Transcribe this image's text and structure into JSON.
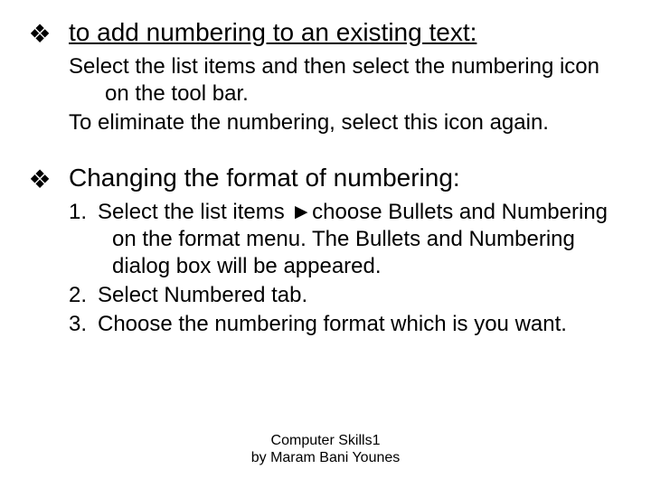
{
  "bullet_symbol": "❖",
  "section1": {
    "heading": "to add numbering to an existing text:",
    "para1": "Select the list items and then select the numbering icon on the tool bar.",
    "para2": "To eliminate the numbering, select this icon again."
  },
  "section2": {
    "heading": "Changing the format of numbering:",
    "items": {
      "n1": "1.",
      "t1": "Select the list items ►choose Bullets and Numbering on the format menu. The Bullets and Numbering dialog box will be appeared.",
      "n2": "2.",
      "t2": "Select Numbered tab.",
      "n3": "3.",
      "t3": "Choose the numbering format which is you want."
    }
  },
  "footer": {
    "line1": "Computer Skills1",
    "line2": "by Maram Bani Younes"
  }
}
